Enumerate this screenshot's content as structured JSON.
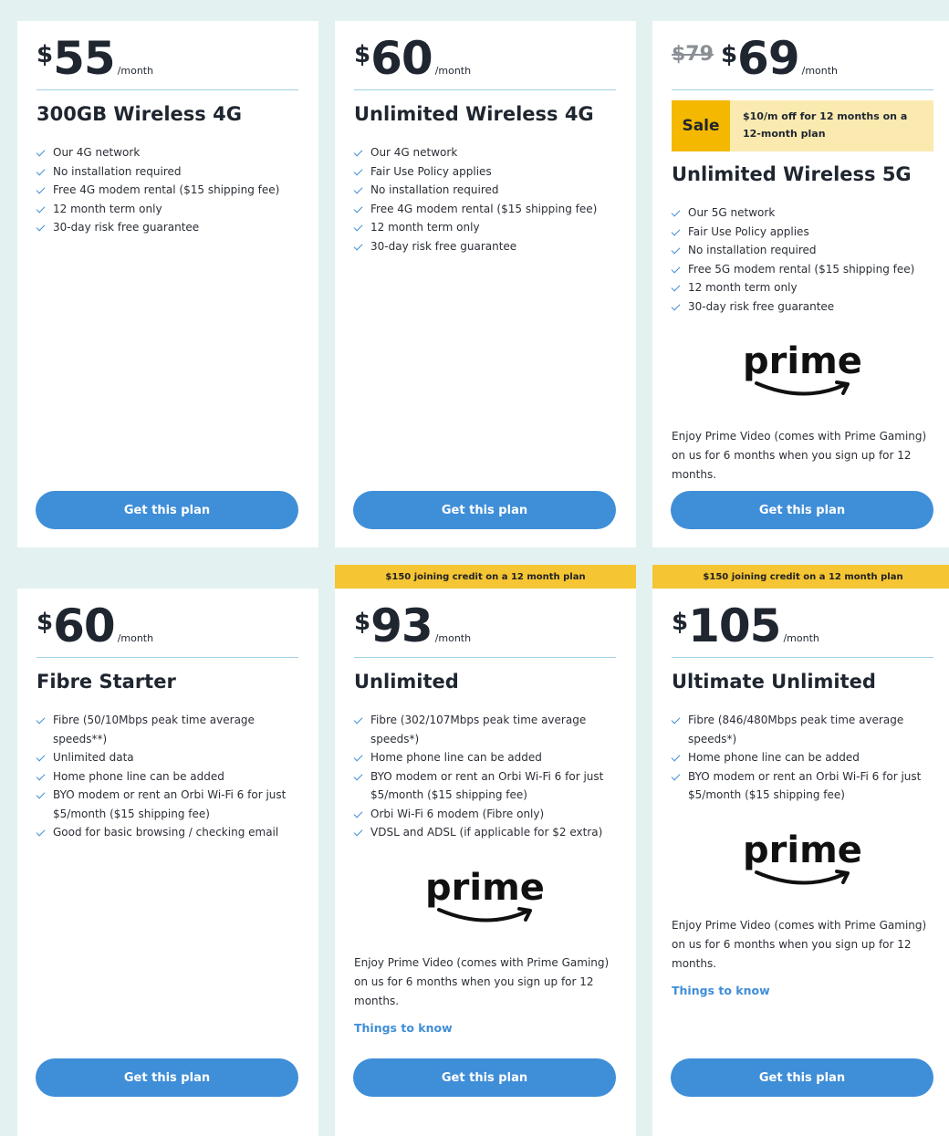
{
  "plans": [
    {
      "dollar": "$",
      "amount": "55",
      "per": "/month",
      "title": "300GB Wireless 4G",
      "features": [
        "Our 4G network",
        "No installation required",
        "Free 4G modem rental ($15 shipping fee)",
        "12 month term only",
        "30-day risk free guarantee"
      ],
      "cta": "Get this plan"
    },
    {
      "dollar": "$",
      "amount": "60",
      "per": "/month",
      "title": "Unlimited Wireless 4G",
      "features": [
        "Our 4G network",
        "Fair Use Policy applies",
        "No installation required",
        "Free 4G modem rental ($15 shipping fee)",
        "12 month term only",
        "30-day risk free guarantee"
      ],
      "cta": "Get this plan"
    },
    {
      "old_price": "$79",
      "dollar": "$",
      "amount": "69",
      "per": "/month",
      "sale_tag": "Sale",
      "sale_text": "$10/m off for 12 months on a 12-month plan",
      "title": "Unlimited Wireless 5G",
      "features": [
        "Our 5G network",
        "Fair Use Policy applies",
        "No installation required",
        "Free 5G modem rental ($15 shipping fee)",
        "12 month term only",
        "30-day risk free guarantee"
      ],
      "prime": "prime",
      "promo": "Enjoy Prime Video (comes with Prime Gaming) on us for 6 months when you sign up for 12 months.",
      "cta": "Get this plan"
    },
    {
      "dollar": "$",
      "amount": "60",
      "per": "/month",
      "title": "Fibre Starter",
      "features": [
        "Fibre (50/10Mbps peak time average speeds**)",
        "Unlimited data",
        "Home phone line can be added",
        "BYO modem or rent an Orbi Wi-Fi 6 for just $5/month ($15 shipping fee)",
        "Good for basic browsing / checking email"
      ],
      "cta": "Get this plan"
    },
    {
      "banner": "$150 joining credit on a 12 month plan",
      "dollar": "$",
      "amount": "93",
      "per": "/month",
      "title": "Unlimited",
      "features": [
        "Fibre (302/107Mbps peak time average speeds*)",
        "Home phone line can be added",
        "BYO modem or rent an Orbi Wi-Fi 6 for just $5/month ($15 shipping fee)",
        "Orbi Wi-Fi 6 modem (Fibre only)",
        "VDSL and ADSL (if applicable for $2 extra)"
      ],
      "prime": "prime",
      "promo": "Enjoy Prime Video (comes with Prime Gaming) on us for 6 months when you sign up for 12 months.",
      "things": "Things to know",
      "cta": "Get this plan"
    },
    {
      "banner": "$150 joining credit on a 12 month plan",
      "dollar": "$",
      "amount": "105",
      "per": "/month",
      "title": "Ultimate Unlimited",
      "features": [
        "Fibre (846/480Mbps peak time average speeds*)",
        "Home phone line can be added",
        "BYO modem or rent an Orbi Wi-Fi 6 for just $5/month ($15 shipping fee)"
      ],
      "prime": "prime",
      "promo": "Enjoy Prime Video (comes with Prime Gaming) on us for 6 months when you sign up for 12 months.",
      "things": "Things to know",
      "cta": "Get this plan"
    }
  ],
  "colors": {
    "page_bg": "#e3f1f1",
    "accent_blue": "#3f8ed8",
    "banner_yellow": "#f5c533",
    "sale_yellow": "#f5b800"
  },
  "icons": [
    "check-icon",
    "prime-smile-logo"
  ]
}
